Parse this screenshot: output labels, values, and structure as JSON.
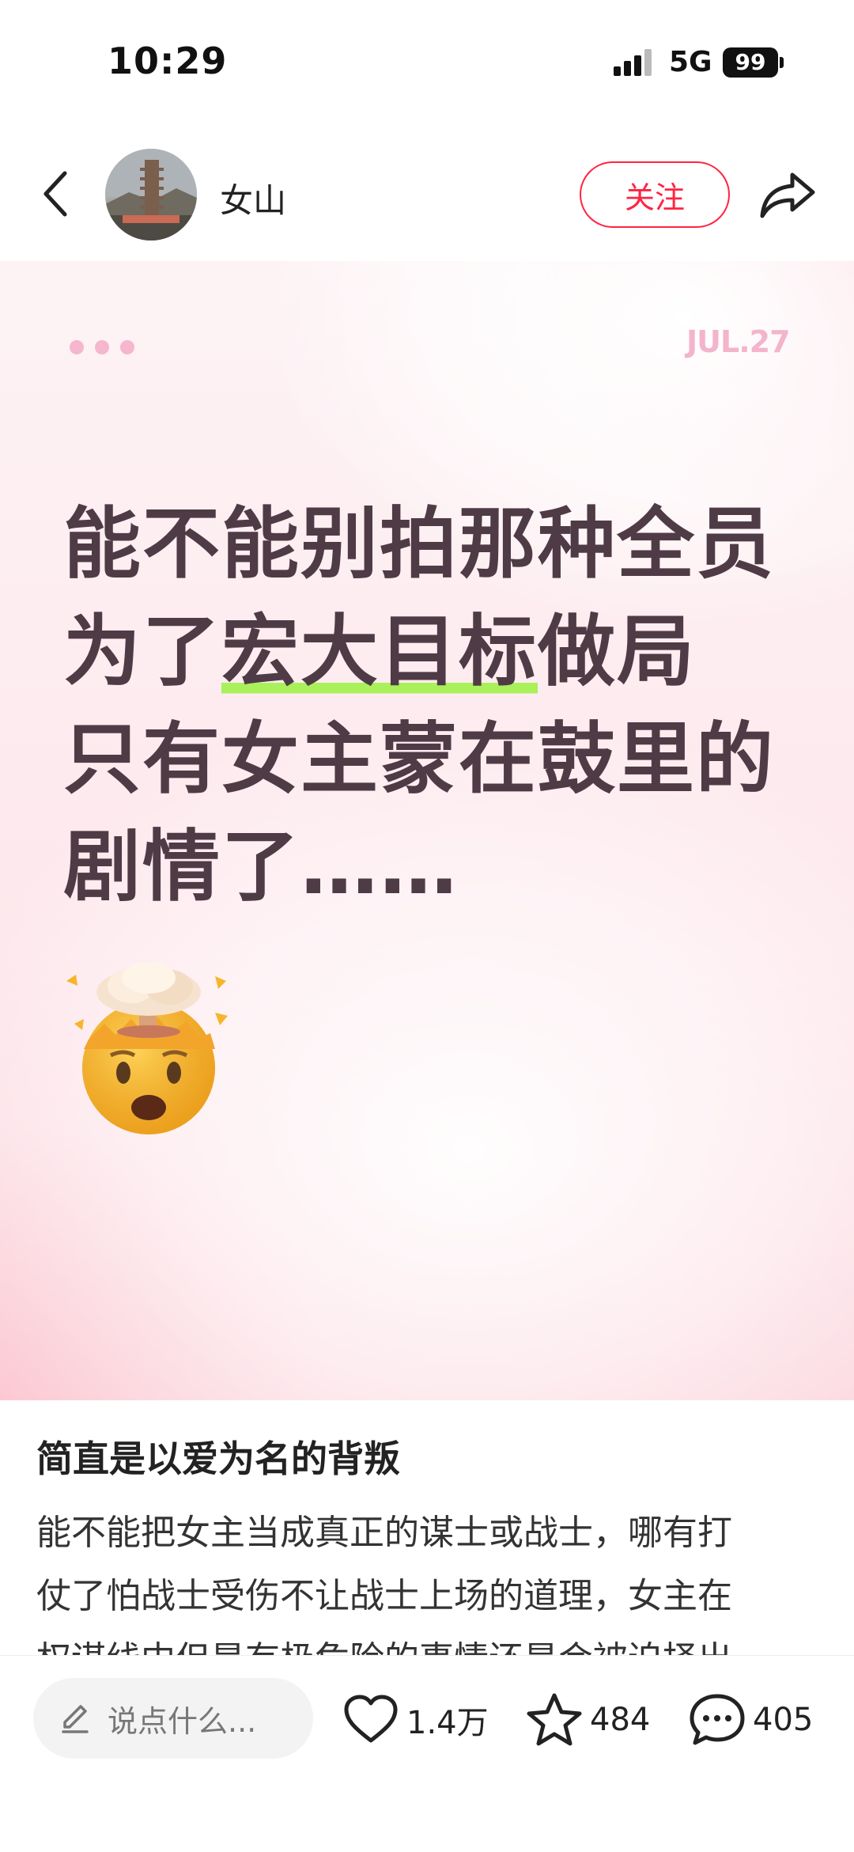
{
  "status_bar": {
    "time": "10:29",
    "network": "5G",
    "battery": "99"
  },
  "header": {
    "author_name": "女山",
    "follow_label": "关注",
    "icons": [
      "back-icon",
      "avatar",
      "share-icon"
    ]
  },
  "note_image": {
    "date_tag": "JUL.27",
    "headline_lines": [
      {
        "before": "能不能别拍那种全员",
        "highlight": "",
        "after": ""
      },
      {
        "before": "为了",
        "highlight": "宏大目标",
        "after": "做局"
      },
      {
        "before": "只有女主蒙在鼓里的",
        "highlight": "",
        "after": ""
      },
      {
        "before": "剧情了……",
        "highlight": "",
        "after": ""
      }
    ],
    "emoji": "exploding-head-emoji",
    "colors": {
      "highlight": "#a9f05a",
      "headline": "#4f3b45",
      "accent_dots": "#f6b6cd"
    }
  },
  "note": {
    "title": "简直是以爱为名的背叛",
    "body_lines": [
      "能不能把女主当成真正的谋士或战士，哪有打",
      "仗了怕战士受伤不让战士上场的道理，女主在",
      "权谋线中但是有极危险的事情还是会被迫择出"
    ]
  },
  "bottom_bar": {
    "comment_placeholder": "说点什么...",
    "likes": "1.4万",
    "collects": "484",
    "comments": "405",
    "accent_color": "#ff2442"
  }
}
